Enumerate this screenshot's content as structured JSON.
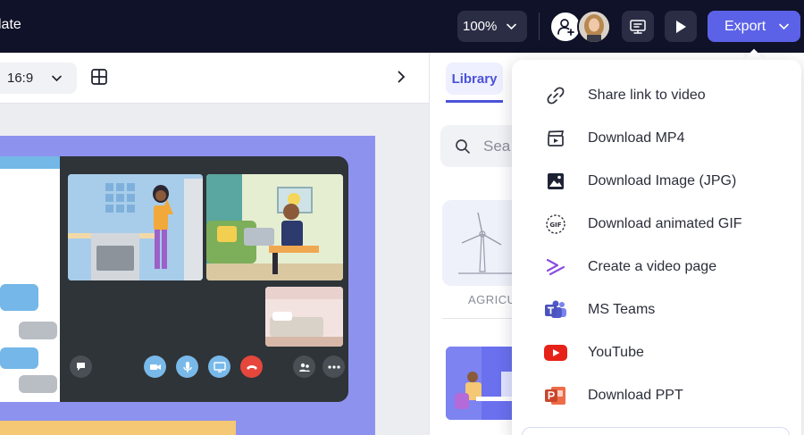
{
  "topbar": {
    "title_fragment": "late",
    "zoom": "100%",
    "export_label": "Export"
  },
  "toolbar": {
    "aspect_ratio": "16:9"
  },
  "library": {
    "tab_label": "Library",
    "search_placeholder": "Sea",
    "card_label": "AGRICU"
  },
  "export_menu": {
    "items": [
      {
        "label": "Share link to video",
        "icon": "link-icon"
      },
      {
        "label": "Download MP4",
        "icon": "video-clapper-icon"
      },
      {
        "label": "Download Image (JPG)",
        "icon": "image-icon"
      },
      {
        "label": "Download animated GIF",
        "icon": "gif-icon"
      },
      {
        "label": "Create a video page",
        "icon": "video-page-icon"
      },
      {
        "label": "MS Teams",
        "icon": "ms-teams-icon"
      },
      {
        "label": "YouTube",
        "icon": "youtube-icon"
      },
      {
        "label": "Download PPT",
        "icon": "powerpoint-icon"
      }
    ]
  },
  "colors": {
    "topbar_bg": "#0f1228",
    "accent": "#5b62e8",
    "slide_bg": "#8e92ef",
    "youtube_red": "#e62117",
    "ppt_orange": "#c9462c",
    "teams_purple": "#5059c9"
  }
}
